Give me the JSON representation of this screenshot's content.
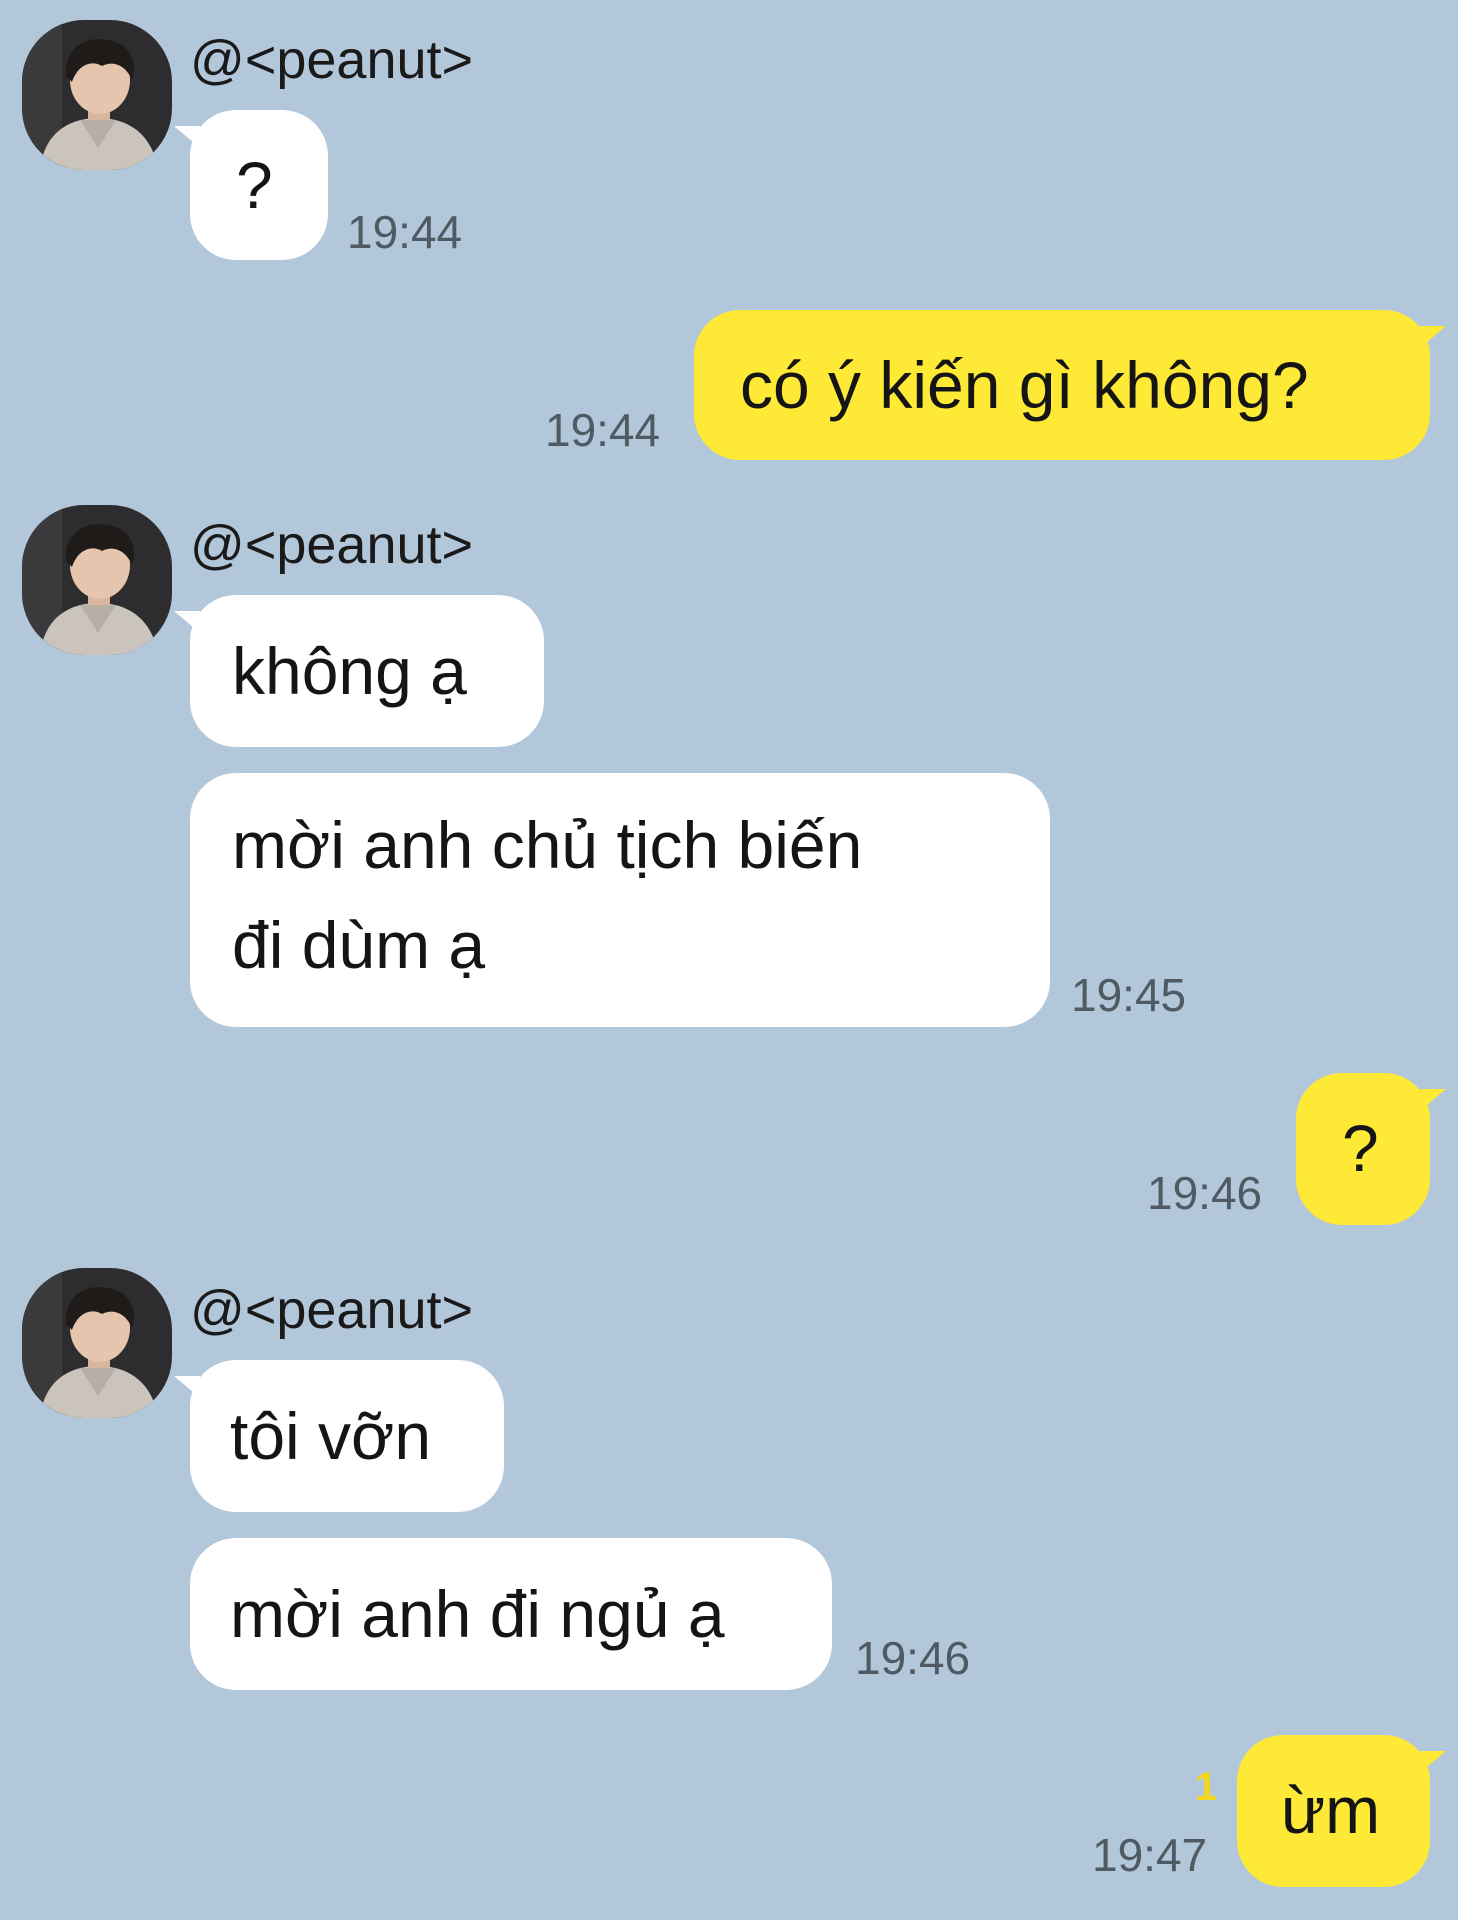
{
  "contact": {
    "name": "@<peanut>",
    "avatar_icon": "person-photo-avatar"
  },
  "colors": {
    "background": "#b2c7da",
    "incoming_bubble": "#ffffff",
    "outgoing_bubble": "#fde936",
    "timestamp": "#4f5a63",
    "unread_count": "#f3d71a"
  },
  "messages": [
    {
      "direction": "in",
      "text": "?",
      "time": "19:44"
    },
    {
      "direction": "out",
      "text": "có ý kiến gì không?",
      "time": "19:44"
    },
    {
      "direction": "in",
      "text": "không ạ"
    },
    {
      "direction": "in",
      "text": "mời anh chủ tịch biến",
      "text2": "đi dùm ạ",
      "time": "19:45"
    },
    {
      "direction": "out",
      "text": "?",
      "time": "19:46"
    },
    {
      "direction": "in",
      "text": "tôi vỡn"
    },
    {
      "direction": "in",
      "text": "mời anh đi ngủ ạ",
      "time": "19:46"
    },
    {
      "direction": "out",
      "text": "ừm",
      "time": "19:47",
      "unread": "1"
    }
  ]
}
